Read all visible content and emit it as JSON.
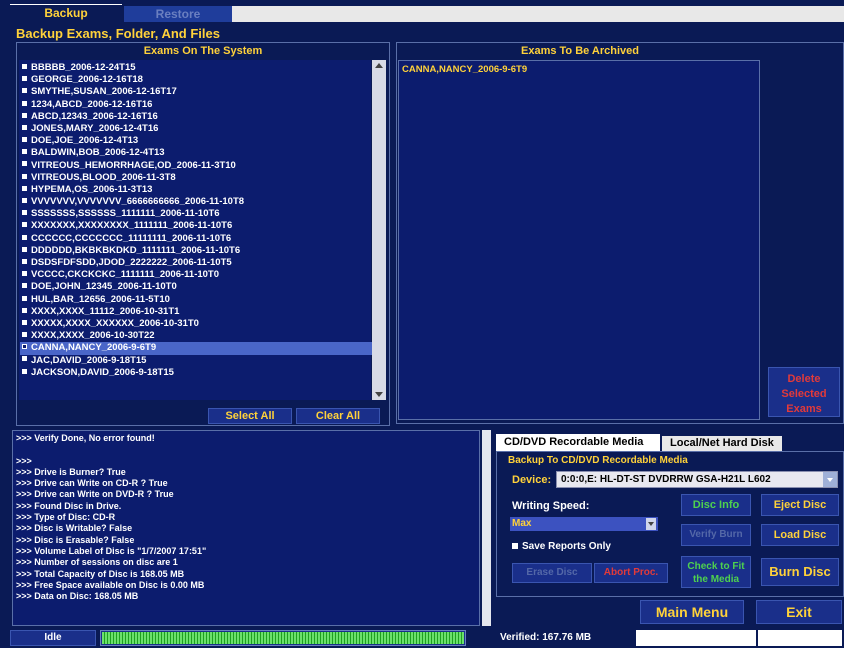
{
  "tabs": {
    "backup": "Backup",
    "restore": "Restore"
  },
  "section_title": "Backup Exams, Folder, And Files",
  "system_panel": {
    "header": "Exams On The System",
    "exams": [
      "BBBBB_2006-12-24T15",
      "GEORGE_2006-12-16T18",
      "SMYTHE,SUSAN_2006-12-16T17",
      "1234,ABCD_2006-12-16T16",
      "ABCD,12343_2006-12-16T16",
      "JONES,MARY_2006-12-4T16",
      "DOE,JOE_2006-12-4T13",
      "BALDWIN,BOB_2006-12-4T13",
      "VITREOUS_HEMORRHAGE,OD_2006-11-3T10",
      "VITREOUS,BLOOD_2006-11-3T8",
      "HYPEMA,OS_2006-11-3T13",
      "VVVVVVV,VVVVVVV_6666666666_2006-11-10T8",
      "SSSSSSS,SSSSSS_1111111_2006-11-10T6",
      "XXXXXXX,XXXXXXXX_1111111_2006-11-10T6",
      "CCCCCC,CCCCCCC_11111111_2006-11-10T6",
      "DDDDDD,BKBKBKDKD_1111111_2006-11-10T6",
      "DSDSFDFSDD,JDOD_2222222_2006-11-10T5",
      "VCCCC,CKCKCKC_1111111_2006-11-10T0",
      "DOE,JOHN_12345_2006-11-10T0",
      "HUL,BAR_12656_2006-11-5T10",
      "XXXX,XXXX_11112_2006-10-31T1",
      "XXXXX,XXXX_XXXXXX_2006-10-31T0",
      "XXXX,XXXX_2006-10-30T22",
      "CANNA,NANCY_2006-9-6T9",
      "JAC,DAVID_2006-9-18T15",
      "JACKSON,DAVID_2006-9-18T15"
    ],
    "selected_index": 23,
    "select_all": "Select All",
    "clear_all": "Clear All"
  },
  "archive_panel": {
    "header": "Exams To Be Archived",
    "items": [
      "CANNA,NANCY_2006-9-6T9"
    ],
    "delete_button": "Delete Selected Exams"
  },
  "log": [
    ">>> Verify Done, No error found!",
    "",
    ">>>",
    ">>> Drive is Burner? True",
    ">>> Drive can Write on CD-R ? True",
    ">>> Drive can Write on DVD-R ? True",
    ">>> Found Disc in Drive.",
    ">>> Type of Disc: CD-R",
    ">>> Disc is Writable? False",
    ">>> Disc is Erasable? False",
    ">>> Volume Label of Disc is \"1/7/2007 17:51\"",
    ">>> Number of sessions on disc are 1",
    ">>> Total Capacity of Disc is 168.05 MB",
    ">>> Free Space available on Disc is 0.00 MB",
    ">>> Data on Disc: 168.05 MB"
  ],
  "media": {
    "tab_cd": "CD/DVD Recordable Media",
    "tab_disk": "Local/Net Hard Disk",
    "subtitle": "Backup To CD/DVD Recordable Media",
    "device_label": "Device:",
    "device_value": "0:0:0,E: HL-DT-ST DVDRRW GSA-H21L L602",
    "speed_label": "Writing Speed:",
    "speed_value": "Max",
    "save_reports": "Save Reports Only",
    "disc_info": "Disc Info",
    "eject_disc": "Eject Disc",
    "verify_burn": "Verify Burn",
    "load_disc": "Load Disc",
    "erase_disc": "Erase Disc",
    "abort_proc": "Abort Proc.",
    "check_fit": "Check to Fit the Media",
    "burn_disc": "Burn Disc"
  },
  "nav": {
    "main_menu": "Main Menu",
    "exit": "Exit"
  },
  "status": {
    "state": "Idle",
    "progress_fraction": 1.0,
    "verified": "Verified: 167.76 MB"
  },
  "colors": {
    "background": "#0a1a55",
    "list_bg": "#0c1c6e",
    "accent_yellow": "#ffd23a",
    "accent_green": "#4ed24e",
    "accent_red": "#e23a3a",
    "selection": "#4a66c8"
  }
}
